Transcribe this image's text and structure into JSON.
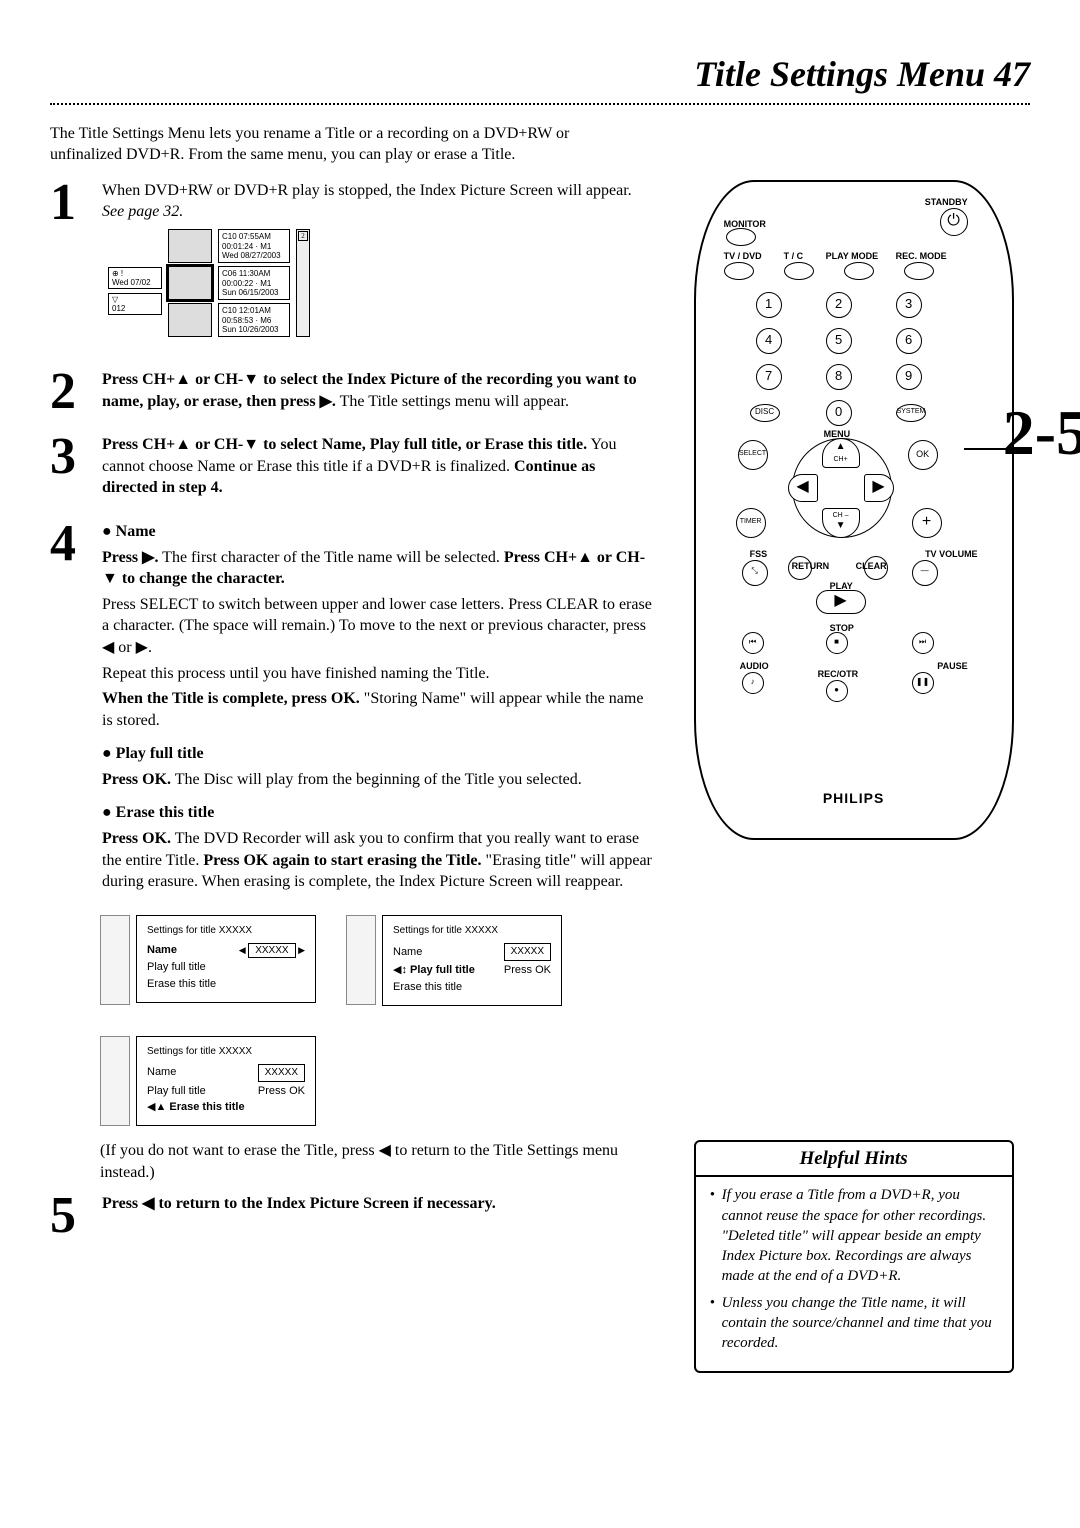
{
  "page_title": "Title Settings Menu  47",
  "intro": "The Title Settings Menu lets you rename a Title or a recording on a DVD+RW or unfinalized DVD+R. From the same menu, you can play or erase a Title.",
  "steps": {
    "s1": {
      "num": "1",
      "p1a": "When DVD+RW or DVD+R play is stopped, the Index Picture Screen will appear. ",
      "p1b": "See page 32."
    },
    "s2": {
      "num": "2",
      "bold1": "Press CH+▲ or CH-▼ to select the Index Picture of the recording you want to name, play, or erase, then press ▶.",
      "line2": " The Title settings menu will appear."
    },
    "s3": {
      "num": "3",
      "bold1": "Press CH+▲ or CH-▼ to select Name, Play full title, or Erase this title.",
      "rest": " You cannot choose Name or Erase this title if a DVD+R is finalized. ",
      "bold2": "Continue as directed in step 4."
    },
    "s4": {
      "num": "4",
      "name_h": "Name",
      "name_l1b": "Press ▶.",
      "name_l1": " The first character of the Title name will be selected. ",
      "name_l2b": "Press CH+▲ or CH-▼ to change the character.",
      "name_l3": "Press SELECT to switch between upper and lower case letters. Press CLEAR to erase a character. (The space will remain.) To move to the next or previous character, press ◀ or ▶.",
      "name_l4": "Repeat this process until you have finished naming the Title.",
      "name_l5b": "When the Title is complete, press OK.",
      "name_l5": " \"Storing Name\" will appear while the name is stored.",
      "play_h": "Play full title",
      "play_b": "Press OK.",
      "play_t": " The Disc will play from the beginning of the Title you selected.",
      "erase_h": "Erase this title",
      "erase_b": "Press OK.",
      "erase_t1": " The DVD Recorder will ask you to confirm that you really want to erase the entire Title. ",
      "erase_b2": "Press OK again to start erasing the Title.",
      "erase_t2": " \"Erasing title\" will appear during erasure. When erasing is complete, the Index Picture Screen will reappear."
    },
    "s5": {
      "num": "5",
      "bold": "Press ◀ to return to the Index Picture Screen if necessary."
    }
  },
  "paren_note": "(If you do not want to erase the Title, press ◀  to return to the Title Settings menu instead.)",
  "screens": {
    "a": {
      "hdr": "Settings for title XXXXX",
      "name": "Name",
      "pft": "Play full title",
      "ett": "Erase this title",
      "val": "XXXXX"
    },
    "b": {
      "hdr": "Settings for title XXXXX",
      "name": "Name",
      "pft": "Play full title",
      "ett": "Erase this title",
      "val": "XXXXX",
      "hint": "Press OK"
    },
    "c": {
      "hdr": "Settings for title XXXXX",
      "name": "Name",
      "pft": "Play full title",
      "ett": "Erase this title",
      "val": "XXXXX",
      "hint": "Press OK"
    }
  },
  "index_preview": {
    "left1": "⊕  !",
    "left1b": "Wed 07/02",
    "left2": "▽",
    "left2b": "012",
    "m1a": "C10 07:55AM",
    "m1b": "00:01:24 · M1",
    "m1c": "Wed 08/27/2003",
    "m2a": "C06 11:30AM",
    "m2b": "00:00:22 · M1",
    "m2c": "Sun 06/15/2003",
    "m3a": "C10 12:01AM",
    "m3b": "00:58:53 · M6",
    "m3c": "Sun 10/26/2003",
    "badge": "2"
  },
  "remote": {
    "labels": {
      "standby": "STANDBY",
      "monitor": "MONITOR",
      "tvdvd": "TV / DVD",
      "tc": "T / C",
      "playmode": "PLAY MODE",
      "recmode": "REC. MODE",
      "disc": "DISC",
      "system": "SYSTEM",
      "menu": "MENU",
      "select": "SELECT",
      "ok": "OK",
      "ch_plus": "CH+",
      "ch_minus": "CH –",
      "timer": "TIMER",
      "fss": "FSS",
      "tvvol": "TV VOLUME",
      "return": "RETURN",
      "clear": "CLEAR",
      "play": "PLAY",
      "stop": "STOP",
      "audio": "AUDIO",
      "pause": "PAUSE",
      "recotr": "REC/OTR"
    },
    "brand": "PHILIPS",
    "callout": "2-5"
  },
  "hints": {
    "title": "Helpful Hints",
    "items": [
      "If you erase a Title from a DVD+R, you cannot reuse the space for other recordings. \"Deleted title\" will appear beside an empty Index Picture box. Recordings are always made at the end of a DVD+R.",
      "Unless you change the Title name, it will contain the source/channel and time that you recorded."
    ]
  }
}
